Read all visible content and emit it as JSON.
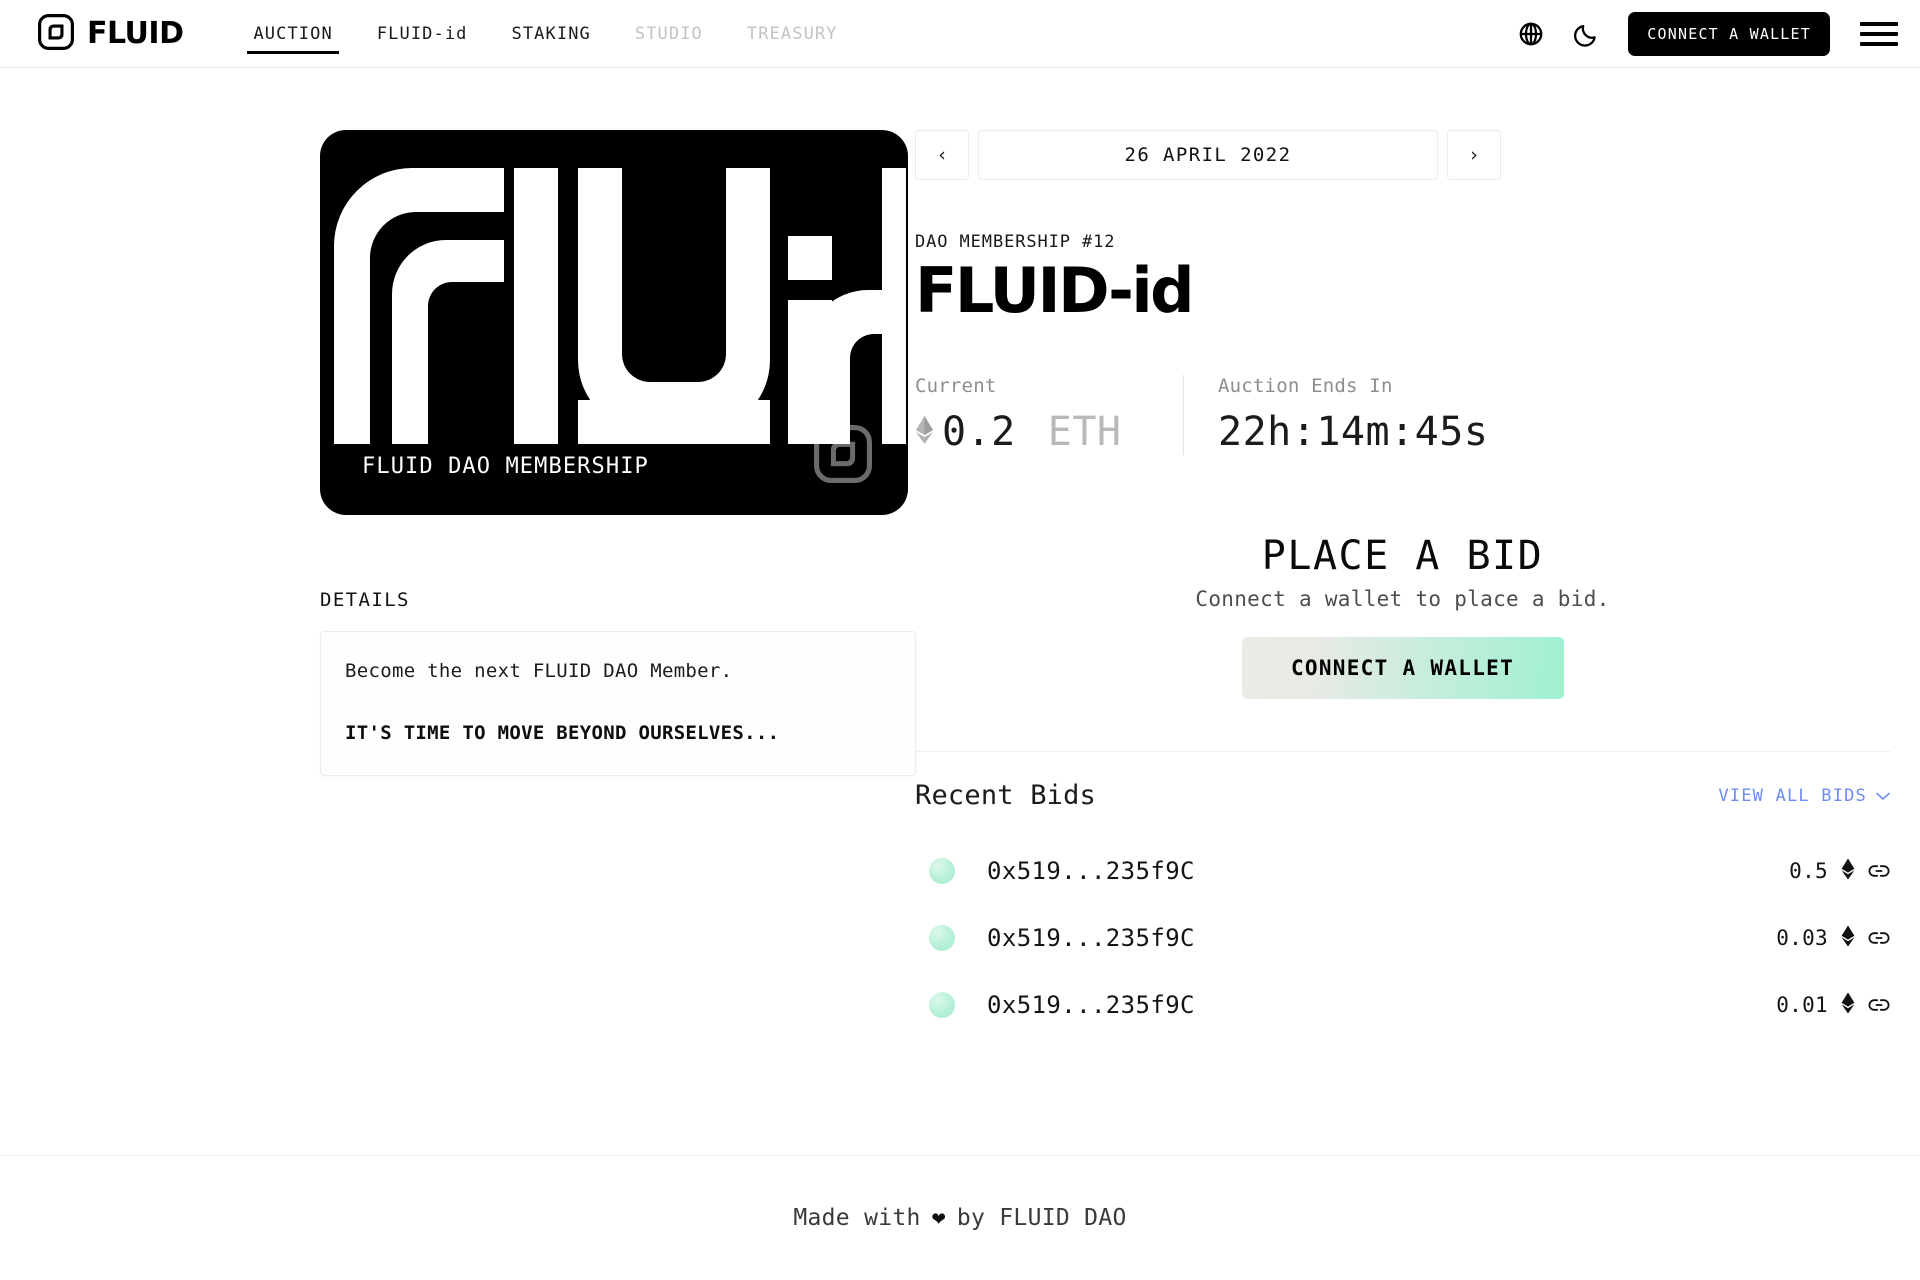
{
  "header": {
    "brand": {
      "name": "FLUID",
      "mark_icon": "fluid-logo-icon"
    },
    "nav": [
      {
        "label": "AUCTION",
        "state": "active"
      },
      {
        "label": "FLUID-id",
        "state": "default"
      },
      {
        "label": "STAKING",
        "state": "default"
      },
      {
        "label": "STUDIO",
        "state": "disabled"
      },
      {
        "label": "TREASURY",
        "state": "disabled"
      }
    ],
    "language_icon": "globe-icon",
    "theme_icon": "moon-icon",
    "connect_label": "CONNECT A WALLET",
    "menu_icon": "hamburger-menu-icon"
  },
  "nft": {
    "wordmark": "fluid",
    "caption": "FLUID DAO MEMBERSHIP",
    "badge_icon": "fluid-logo-icon"
  },
  "details": {
    "heading": "DETAILS",
    "line1": "Become the next FLUID DAO Member.",
    "line2": "IT'S TIME TO MOVE BEYOND OURSELVES..."
  },
  "auction": {
    "prev_icon": "chevron-left-icon",
    "next_icon": "chevron-right-icon",
    "date": "26 APRIL 2022",
    "kicker": "DAO MEMBERSHIP #12",
    "title": "FLUID-id",
    "current_label": "Current",
    "current_value": "0.2",
    "current_unit": "ETH",
    "current_icon": "ethereum-icon",
    "ends_label": "Auction Ends In",
    "ends_value": "22h:14m:45s"
  },
  "place_bid": {
    "heading": "PLACE A BID",
    "subtitle": "Connect a wallet to place a bid.",
    "cta_label": "CONNECT A WALLET"
  },
  "recent_bids": {
    "title": "Recent Bids",
    "view_all_label": "VIEW ALL BIDS",
    "view_all_icon": "chevron-down-icon",
    "rows": [
      {
        "avatar_icon": "avatar-icon",
        "address": "0x519...235f9C",
        "amount": "0.5",
        "currency_icon": "ethereum-icon",
        "link_icon": "external-link-icon"
      },
      {
        "avatar_icon": "avatar-icon",
        "address": "0x519...235f9C",
        "amount": "0.03",
        "currency_icon": "ethereum-icon",
        "link_icon": "external-link-icon"
      },
      {
        "avatar_icon": "avatar-icon",
        "address": "0x519...235f9C",
        "amount": "0.01",
        "currency_icon": "ethereum-icon",
        "link_icon": "external-link-icon"
      }
    ]
  },
  "footer": {
    "made_with": "Made with",
    "heart_icon": "heart-icon",
    "by": "by FLUID DAO"
  },
  "colors": {
    "accent_mint": "#9ff0d0",
    "link_blue": "#6d8cf5",
    "black": "#000000",
    "muted_gray": "#c3c3c3"
  }
}
